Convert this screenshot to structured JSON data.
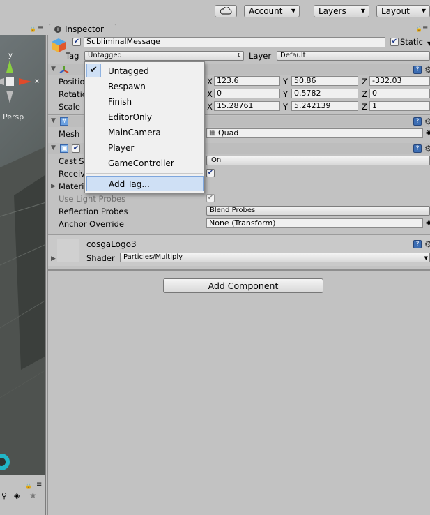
{
  "toolbar": {
    "account_label": "Account",
    "layers_label": "Layers",
    "layout_label": "Layout",
    "cloud_icon": "cloud-icon"
  },
  "scene": {
    "persp_label": "Persp",
    "axis_y": "y",
    "axis_x": "x"
  },
  "inspector": {
    "tab_label": "Inspector",
    "object_name": "SubliminalMessage",
    "static_label": "Static",
    "tag_label": "Tag",
    "tag_value": "Untagged",
    "layer_label": "Layer",
    "layer_value": "Default",
    "transform": {
      "position_label": "Positio",
      "rotation_label": "Rotatio",
      "scale_label": "Scale",
      "axis_x": "X",
      "axis_y": "Y",
      "axis_z": "Z",
      "position": {
        "x": "123.6",
        "y": "50.86",
        "z": "-332.03"
      },
      "rotation": {
        "x": "0",
        "y": "0.5782",
        "z": "0"
      },
      "scale": {
        "x": "15.28761",
        "y": "5.242139",
        "z": "1"
      }
    },
    "mesh_filter": {
      "mesh_label": "Mesh",
      "mesh_value": "Quad"
    },
    "mesh_renderer": {
      "cast_shadows_label": "Cast S",
      "cast_shadows_value": "On",
      "receive_label": "Receiv",
      "materials_label": "Materi",
      "use_light_probes_label": "Use Light Probes",
      "reflection_probes_label": "Reflection Probes",
      "reflection_probes_value": "Blend Probes",
      "anchor_override_label": "Anchor Override",
      "anchor_override_value": "None (Transform)"
    },
    "material": {
      "name": "cosgaLogo3",
      "shader_label": "Shader",
      "shader_value": "Particles/Multiply"
    },
    "add_component_label": "Add Component"
  },
  "tag_menu": {
    "items": [
      "Untagged",
      "Respawn",
      "Finish",
      "EditorOnly",
      "MainCamera",
      "Player",
      "GameController"
    ],
    "add_tag_label": "Add Tag...",
    "checked_index": 0
  },
  "colors": {
    "panel_bg": "#c2c2c2",
    "menu_highlight": "#cfe0f5",
    "help_icon_blue": "#3c6db3"
  }
}
